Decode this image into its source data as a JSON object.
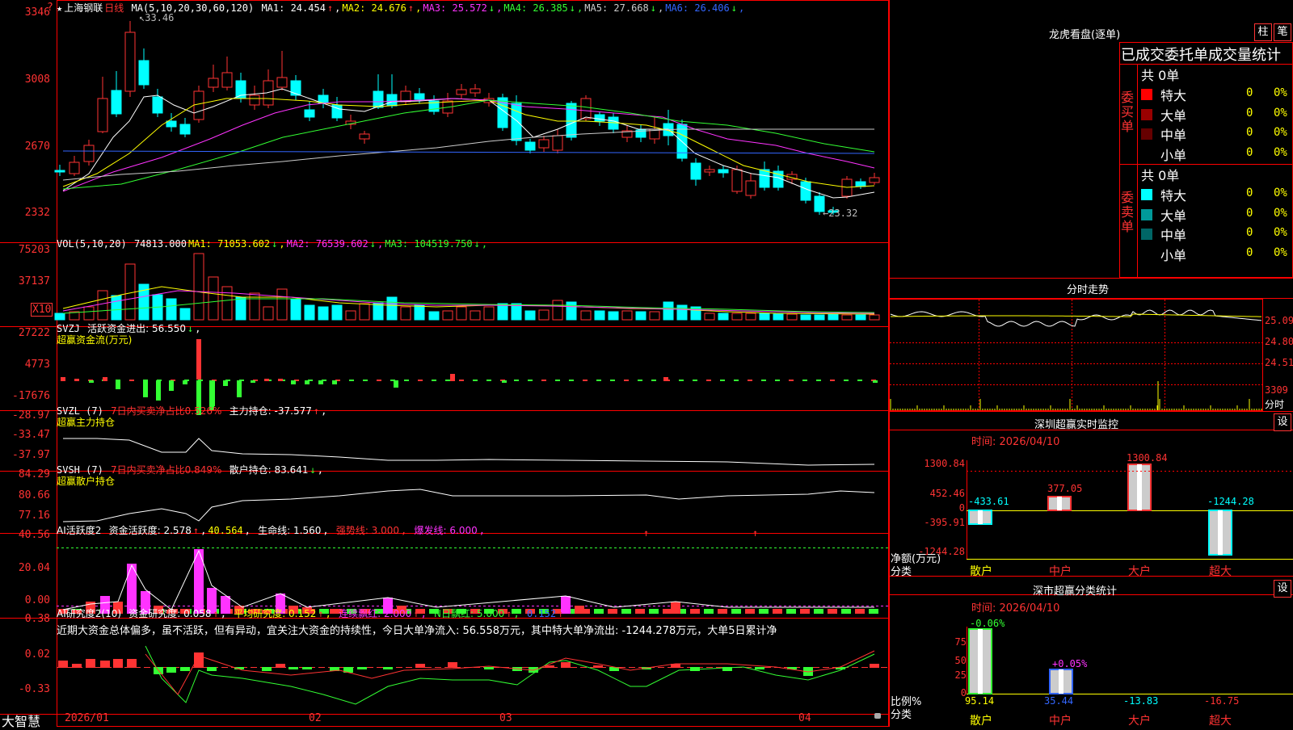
{
  "main": {
    "stock_title": "上海钢联",
    "star": "★",
    "period": "日线",
    "ma_header": "MA(5,10,20,30,60,120)",
    "ma": [
      {
        "label": "MA1: 24.454",
        "arrow": "↑",
        "color": "#ffffff"
      },
      {
        "label": "MA2: 24.676",
        "arrow": "↑",
        "color": "#ffff00"
      },
      {
        "label": "MA3: 25.572",
        "arrow": "↓",
        "color": "#ff33ff"
      },
      {
        "label": "MA4: 26.385",
        "arrow": "↓",
        "color": "#33ff33"
      },
      {
        "label": "MA5: 27.668",
        "arrow": "↓",
        "color": "#cccccc"
      },
      {
        "label": "MA6: 26.406",
        "arrow": "↓",
        "color": "#3366ff"
      }
    ],
    "y_labels": [
      "3346",
      "3008",
      "2670",
      "2332"
    ],
    "y_label_question": "?",
    "high_mark": "33.46",
    "low_mark": "23.32"
  },
  "vol": {
    "header": "VOL(5,10,20)",
    "value": "74813.000",
    "ma": [
      {
        "label": "MA1: 71053.602",
        "arrow": "↓",
        "color": "#ffff00"
      },
      {
        "label": "MA2: 76539.602",
        "arrow": "↓",
        "color": "#ff33ff"
      },
      {
        "label": "MA3: 104519.750",
        "arrow": "↓",
        "color": "#33ff33"
      }
    ],
    "y_labels": [
      "75203",
      "37137"
    ],
    "unit": "X10"
  },
  "svzj": {
    "header": "SVZJ",
    "line1": "活跃资金进出: 56.550",
    "line1_arrow": "↓",
    "line2": "超赢资金流(万元)",
    "y_labels": [
      "27222",
      "4773",
      "-17676"
    ]
  },
  "svzl": {
    "header": "SVZL  (7)",
    "metric": "7日内买卖净占比0.526%",
    "main": "主力持仓: -37.577",
    "main_arrow": "↑",
    "sub": "超赢主力持仓",
    "y_labels": [
      "-28.97",
      "-33.47",
      "-37.97"
    ]
  },
  "svsh": {
    "header": "SVSH  (7)",
    "metric": "7日内买卖净占比0.849%",
    "main": "散户持仓: 83.641",
    "main_arrow": "↓",
    "sub": "超赢散户持仓",
    "y_labels": [
      "84.29",
      "80.66",
      "77.16"
    ]
  },
  "ai1": {
    "header": "AI活跃度2",
    "act": "资金活跃度: 2.578",
    "act_arrow": "↑",
    "v2": "40.564",
    "life": "生命线: 1.560",
    "strong": "强势线: 3.000",
    "burst": "爆发线: 6.000",
    "y_labels": [
      "40.56",
      "20.04",
      "0.00"
    ]
  },
  "ai2": {
    "header": "AI研究度2(10)",
    "r1": "资金研究度: 0.058",
    "r2": "平均研究度: 0.152",
    "r3": "连续飘红: 2.000",
    "r4": "N日飘红: 5.000",
    "r5": "0.152",
    "comment": "近期大资金总体偏多，虽不活跃，但有异动，宜关注大资金的持续性，今日大单净流入: 56.558万元，其中特大单净流出: -1244.278万元，大单5日累计净",
    "y_labels": [
      "0.38",
      "0.02",
      "-0.33"
    ]
  },
  "xaxis": {
    "labels": [
      "2026/01",
      "02",
      "03",
      "04"
    ],
    "brand": "大智慧"
  },
  "right": {
    "tabs": [
      "柱",
      "笔"
    ],
    "lhb_title": "龙虎看盘(逐单)",
    "stat_title": "已成交委托单成交量统计",
    "buy": {
      "label": "委买单",
      "total": "共 0单",
      "rows": [
        {
          "name": "特大",
          "val": "0",
          "pct": "0%",
          "color": "#ff0000"
        },
        {
          "name": "大单",
          "val": "0",
          "pct": "0%",
          "color": "#990000"
        },
        {
          "name": "中单",
          "val": "0",
          "pct": "0%",
          "color": "#660000"
        },
        {
          "name": "小单",
          "val": "0",
          "pct": "0%",
          "color": "#000000"
        }
      ]
    },
    "sell": {
      "label": "委卖单",
      "total": "共 0单",
      "rows": [
        {
          "name": "特大",
          "val": "0",
          "pct": "0%",
          "color": "#00ffff"
        },
        {
          "name": "大单",
          "val": "0",
          "pct": "0%",
          "color": "#009999"
        },
        {
          "name": "中单",
          "val": "0",
          "pct": "0%",
          "color": "#006666"
        },
        {
          "name": "小单",
          "val": "0",
          "pct": "0%",
          "color": "#000000"
        }
      ]
    },
    "fenshi": {
      "title": "分时走势",
      "y_labels": [
        "25.09",
        "24.80",
        "24.51",
        "3309"
      ],
      "unit": "分时"
    },
    "sz_monitor": {
      "title": "深圳超赢实时监控",
      "set": "设",
      "time": "时间: 2026/04/10",
      "y_labels": [
        "1300.84",
        "452.46",
        "0",
        "-395.91",
        "-1244.28"
      ],
      "net_label": "净额(万元)",
      "cat_label": "分类",
      "categories": [
        "散户",
        "中户",
        "大户",
        "超大"
      ],
      "values": [
        "-433.61",
        "377.05",
        "1300.84",
        "-1244.28"
      ]
    },
    "sz_class": {
      "title": "深市超赢分类统计",
      "set": "设",
      "time": "时间: 2026/04/10",
      "y_labels": [
        "75",
        "50",
        "25",
        "0"
      ],
      "ratio_label": "比例%",
      "cat_label": "分类",
      "categories": [
        "散户",
        "中户",
        "大户",
        "超大"
      ],
      "top_labels": [
        "-0.06%",
        "+0.05%"
      ],
      "values": [
        "95.14",
        "35.44",
        "-13.83",
        "-16.75"
      ]
    }
  },
  "colors": {
    "up": "#ff3333",
    "down": "#00ffff",
    "grid": "#ff0000",
    "green": "#33ff33",
    "magenta": "#ff33ff",
    "yellow": "#ffff00"
  }
}
